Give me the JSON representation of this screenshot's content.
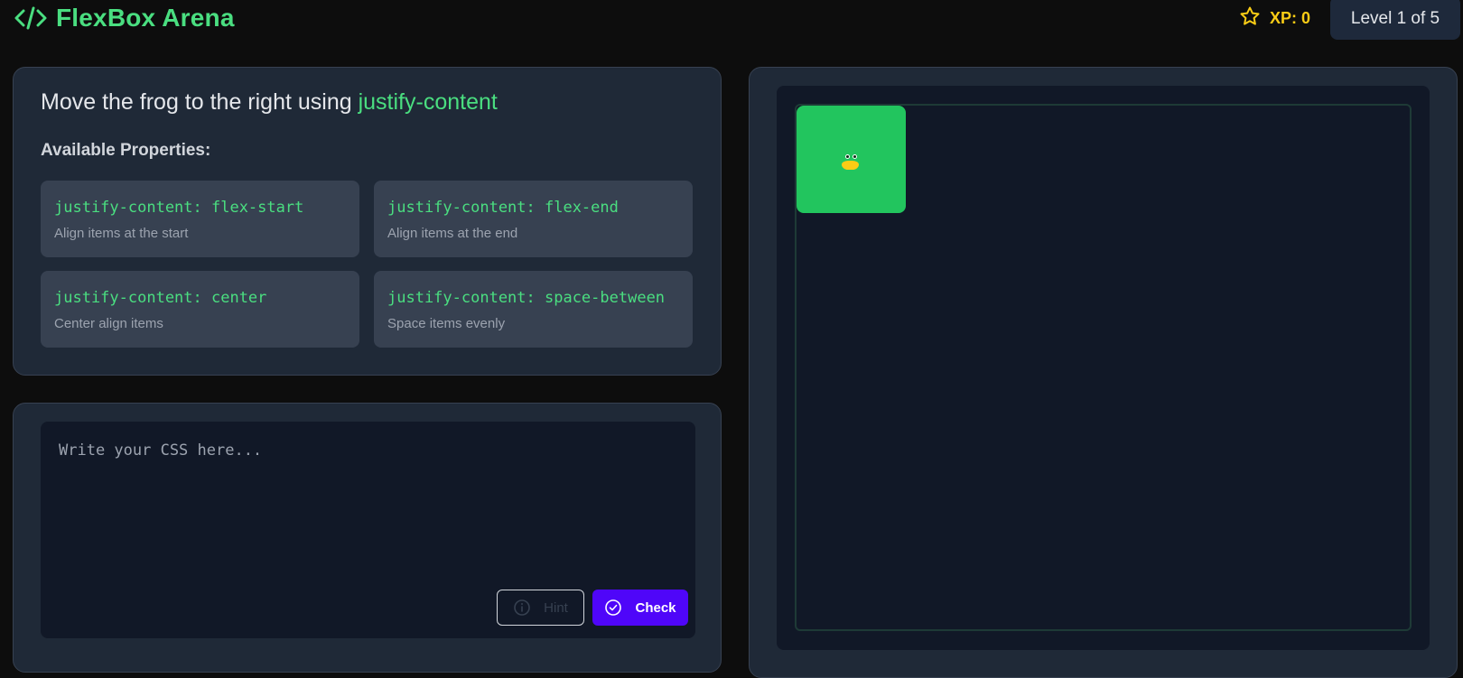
{
  "header": {
    "app_title": "FlexBox Arena",
    "logo_icon": "code-icon",
    "xp_icon": "star-icon",
    "xp_label": "XP: 0",
    "level_label": "Level 1 of 5"
  },
  "instructions": {
    "task_text": "Move the frog to the right using ",
    "task_keyword": "justify-content",
    "properties_heading": "Available Properties:",
    "properties": [
      {
        "code": "justify-content: flex-start",
        "description": "Align items at the start"
      },
      {
        "code": "justify-content: flex-end",
        "description": "Align items at the end"
      },
      {
        "code": "justify-content: center",
        "description": "Center align items"
      },
      {
        "code": "justify-content: space-between",
        "description": "Space items evenly"
      }
    ]
  },
  "editor": {
    "placeholder": "Write your CSS here...",
    "value": "",
    "hint_label": "Hint",
    "hint_icon": "info-icon",
    "check_label": "Check",
    "check_icon": "check-circle-icon"
  },
  "board": {
    "frog_position": "flex-start"
  },
  "colors": {
    "background": "#0d0d0d",
    "panel": "#1f2937",
    "accent_green": "#4ade80",
    "frog_green": "#22c55e",
    "xp_yellow": "#facc15",
    "check_button": "#4f06f9"
  }
}
